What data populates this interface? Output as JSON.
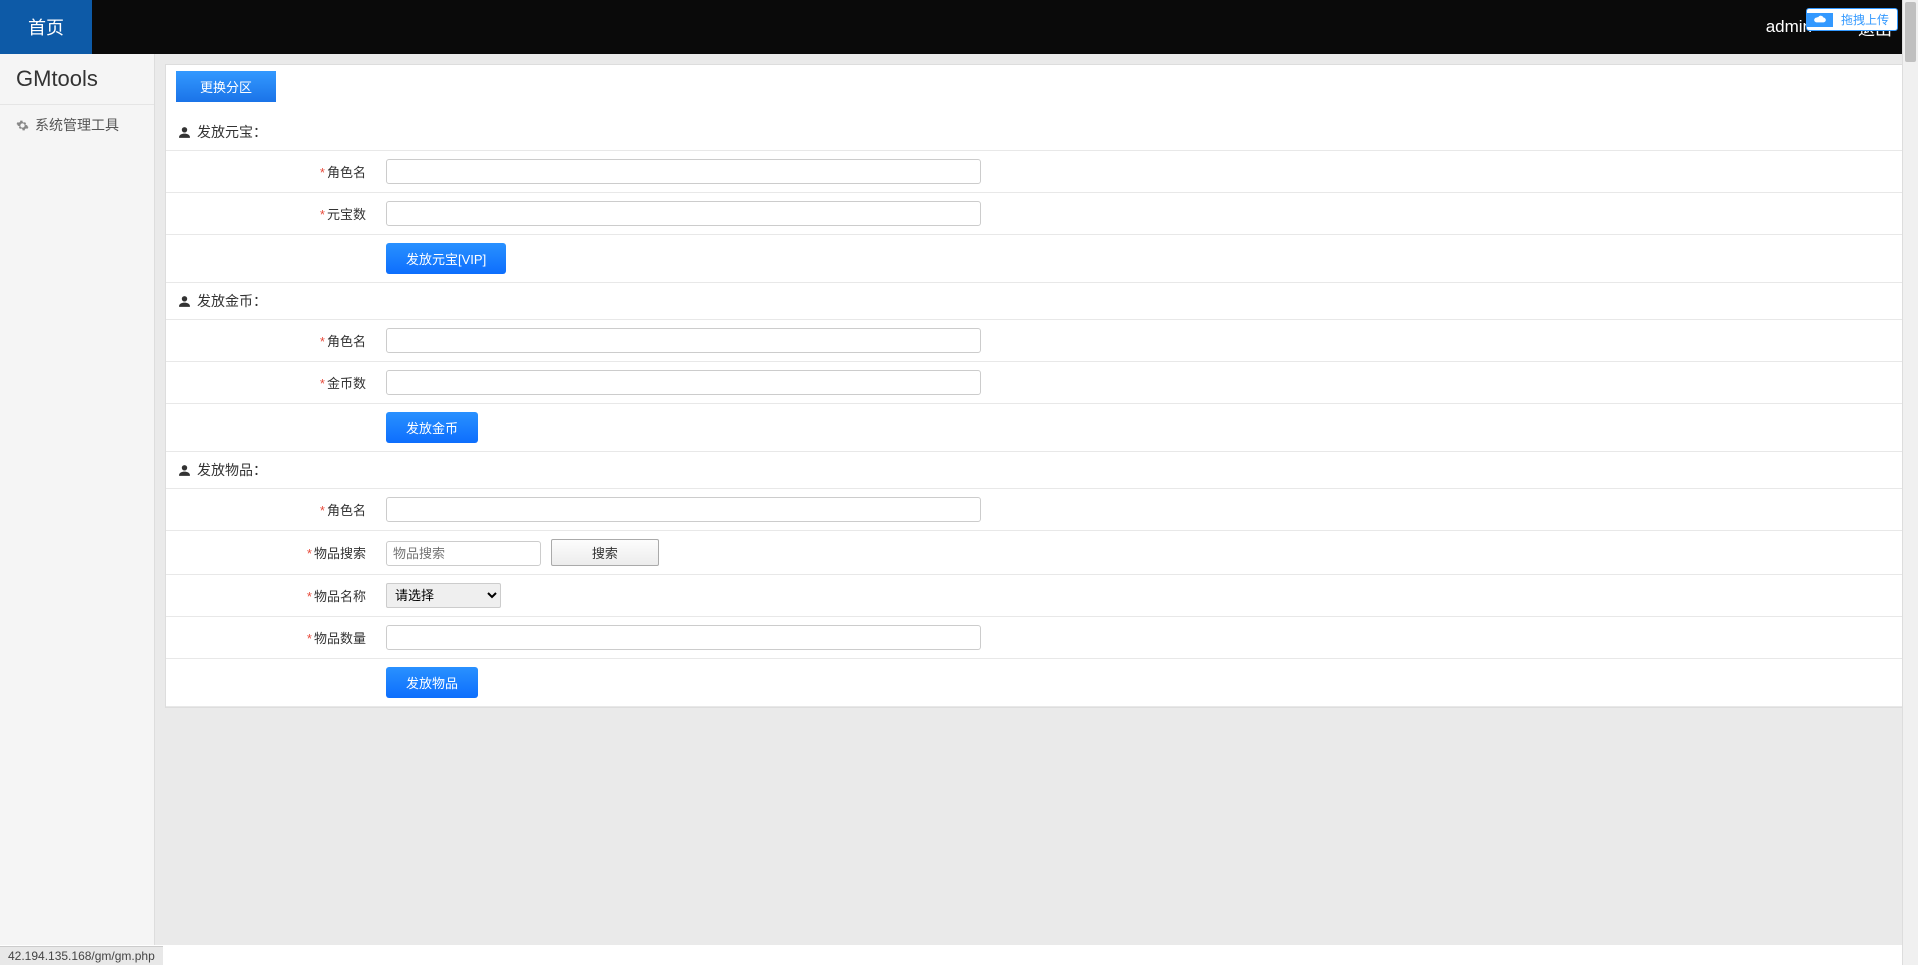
{
  "nav": {
    "home": "首页",
    "user": "admin",
    "logout": "退出"
  },
  "upload_badge": "拖拽上传",
  "sidebar": {
    "logo": "GMtools",
    "items": [
      {
        "label": "系统管理工具"
      }
    ]
  },
  "switch_zone_btn": "更换分区",
  "sections": {
    "yuanbao": {
      "title": "发放元宝：",
      "fields": {
        "role_label": "角色名",
        "amount_label": "元宝数"
      },
      "submit": "发放元宝[VIP]"
    },
    "gold": {
      "title": "发放金币：",
      "fields": {
        "role_label": "角色名",
        "amount_label": "金币数"
      },
      "submit": "发放金币"
    },
    "item": {
      "title": "发放物品：",
      "fields": {
        "role_label": "角色名",
        "search_label": "物品搜索",
        "search_placeholder": "物品搜索",
        "search_btn": "搜索",
        "name_label": "物品名称",
        "name_placeholder": "请选择",
        "qty_label": "物品数量"
      },
      "submit": "发放物品"
    }
  },
  "status_bar": "42.194.135.168/gm/gm.php"
}
